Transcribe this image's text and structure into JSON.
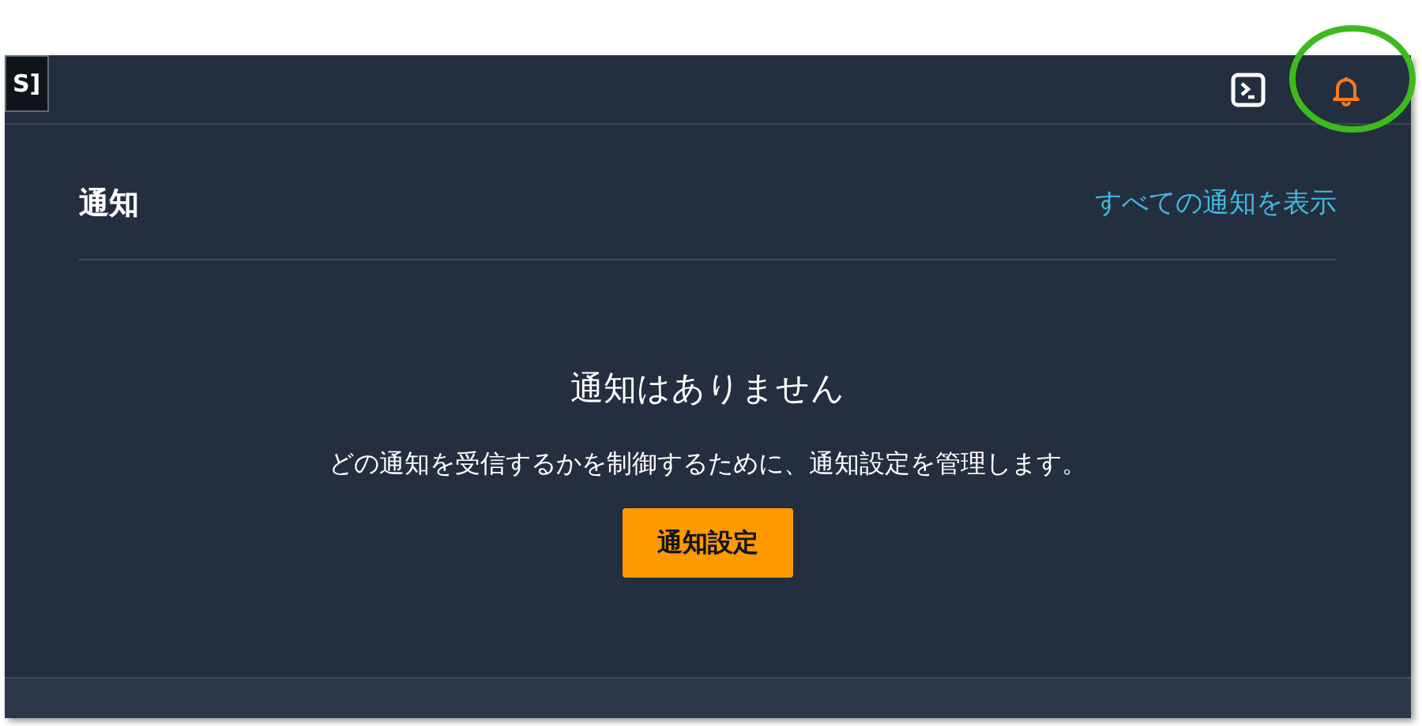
{
  "top_bar": {
    "cut_button": "S]"
  },
  "panel": {
    "title": "通知",
    "view_all_link": "すべての通知を表示",
    "empty_title": "通知はありません",
    "empty_message": "どの通知を受信するかを制御するために、通知設定を管理します。",
    "settings_button": "通知設定"
  }
}
